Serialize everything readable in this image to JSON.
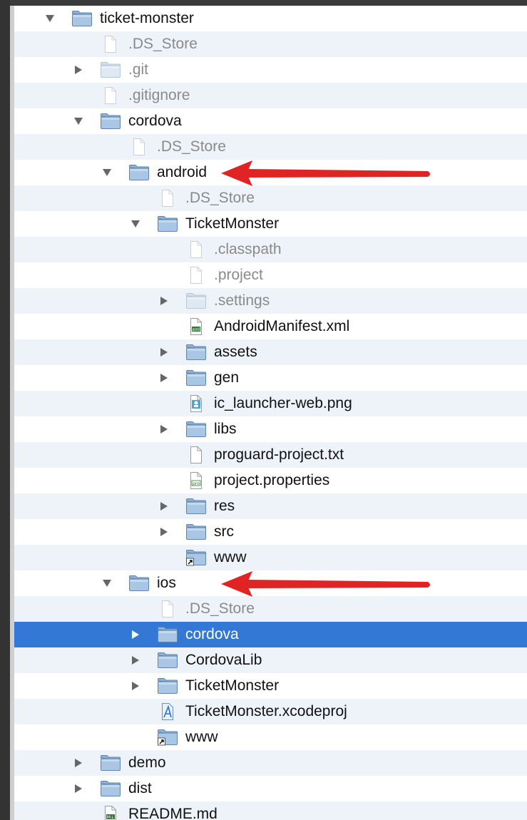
{
  "tree": {
    "rows": [
      {
        "label": "ticket-monster",
        "depth": 0,
        "kind": "folder",
        "expanded": true,
        "muted": false
      },
      {
        "label": ".DS_Store",
        "depth": 1,
        "kind": "file",
        "muted": true
      },
      {
        "label": ".git",
        "depth": 1,
        "kind": "folder",
        "expanded": false,
        "muted": true
      },
      {
        "label": ".gitignore",
        "depth": 1,
        "kind": "file",
        "muted": true
      },
      {
        "label": "cordova",
        "depth": 1,
        "kind": "folder",
        "expanded": true,
        "muted": false
      },
      {
        "label": ".DS_Store",
        "depth": 2,
        "kind": "file",
        "muted": true
      },
      {
        "label": "android",
        "depth": 2,
        "kind": "folder",
        "expanded": true,
        "muted": false
      },
      {
        "label": ".DS_Store",
        "depth": 3,
        "kind": "file",
        "muted": true
      },
      {
        "label": "TicketMonster",
        "depth": 3,
        "kind": "folder",
        "expanded": true,
        "muted": false
      },
      {
        "label": ".classpath",
        "depth": 4,
        "kind": "file",
        "muted": true
      },
      {
        "label": ".project",
        "depth": 4,
        "kind": "file",
        "muted": true
      },
      {
        "label": ".settings",
        "depth": 4,
        "kind": "folder",
        "expanded": false,
        "muted": true
      },
      {
        "label": "AndroidManifest.xml",
        "depth": 4,
        "kind": "xml",
        "muted": false
      },
      {
        "label": "assets",
        "depth": 4,
        "kind": "folder",
        "expanded": false,
        "muted": false
      },
      {
        "label": "gen",
        "depth": 4,
        "kind": "folder",
        "expanded": false,
        "muted": false
      },
      {
        "label": "ic_launcher-web.png",
        "depth": 4,
        "kind": "png",
        "muted": false
      },
      {
        "label": "libs",
        "depth": 4,
        "kind": "folder",
        "expanded": false,
        "muted": false
      },
      {
        "label": "proguard-project.txt",
        "depth": 4,
        "kind": "file",
        "muted": false
      },
      {
        "label": "project.properties",
        "depth": 4,
        "kind": "pro",
        "muted": false
      },
      {
        "label": "res",
        "depth": 4,
        "kind": "folder",
        "expanded": false,
        "muted": false
      },
      {
        "label": "src",
        "depth": 4,
        "kind": "folder",
        "expanded": false,
        "muted": false
      },
      {
        "label": "www",
        "depth": 4,
        "kind": "alias",
        "muted": false
      },
      {
        "label": "ios",
        "depth": 2,
        "kind": "folder",
        "expanded": true,
        "muted": false
      },
      {
        "label": ".DS_Store",
        "depth": 3,
        "kind": "file",
        "muted": true
      },
      {
        "label": "cordova",
        "depth": 3,
        "kind": "folder",
        "expanded": false,
        "muted": false,
        "selected": true
      },
      {
        "label": "CordovaLib",
        "depth": 3,
        "kind": "folder",
        "expanded": false,
        "muted": false
      },
      {
        "label": "TicketMonster",
        "depth": 3,
        "kind": "folder",
        "expanded": false,
        "muted": false
      },
      {
        "label": "TicketMonster.xcodeproj",
        "depth": 3,
        "kind": "xcodeproj",
        "muted": false
      },
      {
        "label": "www",
        "depth": 3,
        "kind": "alias",
        "muted": false
      },
      {
        "label": "demo",
        "depth": 1,
        "kind": "folder",
        "expanded": false,
        "muted": false
      },
      {
        "label": "dist",
        "depth": 1,
        "kind": "folder",
        "expanded": false,
        "muted": false
      },
      {
        "label": "README.md",
        "depth": 1,
        "kind": "md",
        "muted": false
      }
    ]
  },
  "colors": {
    "selection": "#3378d4",
    "arrow": "#e02424",
    "folder": "#a9c6e4",
    "row_alt": "#eef3fa"
  },
  "annotations": [
    {
      "points_to_row": 6,
      "icon": "red-arrow-icon"
    },
    {
      "points_to_row": 22,
      "icon": "red-arrow-icon"
    }
  ]
}
